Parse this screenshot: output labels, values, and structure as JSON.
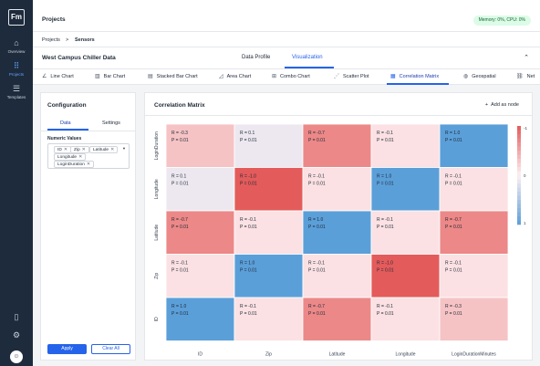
{
  "rail": {
    "items": [
      {
        "icon": "⌂",
        "label": "Overview"
      },
      {
        "icon": "⠿",
        "label": "Projects"
      },
      {
        "icon": "☰",
        "label": "Templates"
      }
    ],
    "avatar": "☺"
  },
  "topbar": {
    "title": "Projects",
    "memory": "Memory: 0%, CPU: 0%"
  },
  "breadcrumb": {
    "root": "Projects",
    "sep": ">",
    "current": "Sensors"
  },
  "page": {
    "title": "West Campus Chiller Data",
    "tabs": [
      "Data Profile",
      "Visualization"
    ],
    "active_tab": "Visualization"
  },
  "chart_tabs": [
    {
      "icon": "∠",
      "label": "Line Chart"
    },
    {
      "icon": "▥",
      "label": "Bar Chart"
    },
    {
      "icon": "▤",
      "label": "Stacked Bar Chart"
    },
    {
      "icon": "◿",
      "label": "Area Chart"
    },
    {
      "icon": "⊞",
      "label": "Combo Chart"
    },
    {
      "icon": "⋰",
      "label": "Scatter Plot"
    },
    {
      "icon": "▦",
      "label": "Correlation Matrix"
    },
    {
      "icon": "◍",
      "label": "Geospatial"
    },
    {
      "icon": "⛓",
      "label": "Net"
    }
  ],
  "config": {
    "title": "Configuration",
    "tabs": [
      "Data",
      "Settings"
    ],
    "numeric_label": "Numeric Values",
    "chips": [
      "ID",
      "Zip",
      "Latitude",
      "Longitude",
      "LoginDuration"
    ],
    "apply": "Apply",
    "clear": "Clear All"
  },
  "matrix_panel": {
    "title": "Correlation Matrix",
    "add_node": "Add as node"
  },
  "chart_data": {
    "type": "heatmap",
    "rows": [
      "LoginDuration",
      "Longitude",
      "Latitude",
      "Zip",
      "ID"
    ],
    "columns": [
      "ID",
      "Zip",
      "Latitude",
      "Longitude",
      "LoginDurationMinutes"
    ],
    "r_values": [
      [
        "-0.3",
        "0.1",
        "-0.7",
        "-0.1",
        "1.0"
      ],
      [
        "0.1",
        "-1.0",
        "-0.1",
        "1.0",
        "-0.1"
      ],
      [
        "-0.7",
        "-0.1",
        "1.0",
        "-0.1",
        "-0.7"
      ],
      [
        "-0.1",
        "1.0",
        "-0.1",
        "-1.0",
        "-0.1"
      ],
      [
        "1.0",
        "-0.1",
        "-0.7",
        "-0.1",
        "-0.3"
      ]
    ],
    "p_value": "0.01",
    "r_prefix": "R = ",
    "p_prefix": "P = ",
    "colorbar": {
      "min": -1,
      "max": 1,
      "tick_labels": [
        "-1",
        "0",
        "1"
      ]
    },
    "colors": {
      "negative": "#e45b5b",
      "neutral": "#fdf0f2",
      "positive": "#5b9fd9"
    }
  }
}
